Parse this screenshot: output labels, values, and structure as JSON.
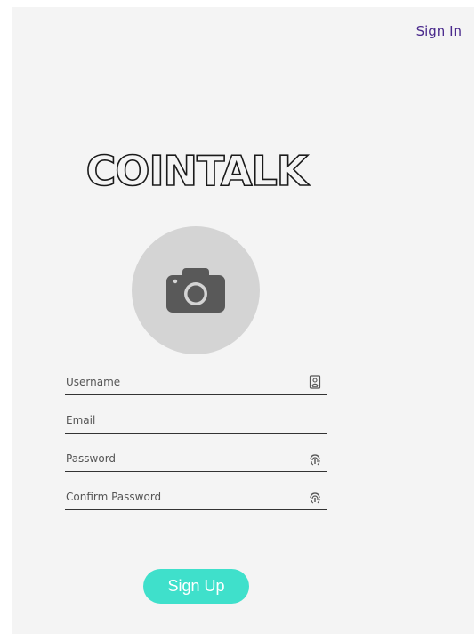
{
  "header": {
    "sign_in_label": "Sign In"
  },
  "brand": {
    "logo_text": "COINTALK"
  },
  "avatar": {
    "icon": "camera-icon"
  },
  "form": {
    "username_placeholder": "Username",
    "email_placeholder": "Email",
    "password_placeholder": "Password",
    "confirm_password_placeholder": "Confirm Password",
    "username_icon": "contact-card-icon",
    "password_icon": "fingerprint-icon",
    "confirm_password_icon": "fingerprint-icon"
  },
  "actions": {
    "sign_up_label": "Sign Up"
  },
  "colors": {
    "background": "#f4f4f4",
    "link": "#4a2a8c",
    "accent": "#3fe0cb",
    "avatar_bg": "#d4d4d4",
    "field_line": "#333333"
  }
}
